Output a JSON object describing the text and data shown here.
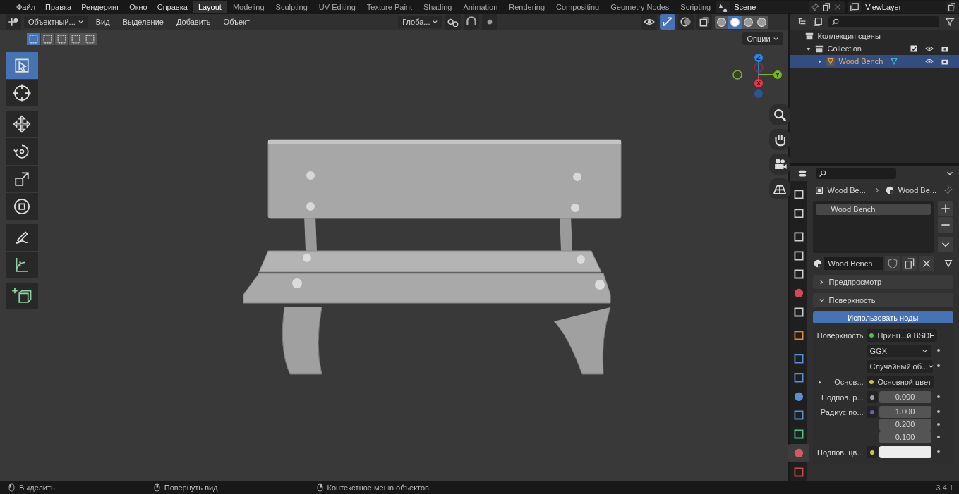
{
  "menu_bar": {
    "items": [
      "Файл",
      "Правка",
      "Рендеринг",
      "Окно",
      "Справка"
    ]
  },
  "workspace_tabs": [
    {
      "label": "Layout",
      "selected": true
    },
    {
      "label": "Modeling",
      "selected": false
    },
    {
      "label": "Sculpting",
      "selected": false
    },
    {
      "label": "UV Editing",
      "selected": false
    },
    {
      "label": "Texture Paint",
      "selected": false
    },
    {
      "label": "Shading",
      "selected": false
    },
    {
      "label": "Animation",
      "selected": false
    },
    {
      "label": "Rendering",
      "selected": false
    },
    {
      "label": "Compositing",
      "selected": false
    },
    {
      "label": "Geometry Nodes",
      "selected": false
    },
    {
      "label": "Scripting",
      "selected": false
    }
  ],
  "scene": {
    "name": "Scene"
  },
  "view_layer": {
    "name": "ViewLayer"
  },
  "viewport_header": {
    "mode": "Объектный...",
    "menus": [
      "Вид",
      "Выделение",
      "Добавить",
      "Объект"
    ],
    "orientation": "Глоба...",
    "options": "Опции",
    "shading_modes": [
      {
        "selected": false
      },
      {
        "selected": true
      },
      {
        "selected": false
      },
      {
        "selected": false
      }
    ],
    "select_modes": [
      {
        "selected": true
      },
      {
        "selected": false
      },
      {
        "selected": false
      },
      {
        "selected": false
      },
      {
        "selected": false
      }
    ]
  },
  "tools": [
    {
      "kind": "select",
      "selected": true
    },
    {
      "kind": "cursor",
      "selected": false
    },
    {
      "kind": "move",
      "selected": false
    },
    {
      "kind": "rotate",
      "selected": false
    },
    {
      "kind": "scale",
      "selected": false
    },
    {
      "kind": "transform",
      "selected": false
    },
    {
      "kind": "annotate",
      "selected": false
    },
    {
      "kind": "measure",
      "selected": false
    },
    {
      "kind": "add",
      "selected": false
    }
  ],
  "gizmo": [
    {
      "label": "Z",
      "color": "#2f83e3"
    },
    {
      "label": "Y",
      "color": "#7ab61f"
    },
    {
      "label": "X",
      "color": "#e8364f"
    }
  ],
  "outliner": {
    "root": "Коллекция сцены",
    "children": [
      {
        "name": "Collection",
        "expanded": true,
        "children": [
          {
            "name": "Wood Bench",
            "selected": true,
            "expanded": false
          }
        ]
      }
    ]
  },
  "properties": {
    "tabs": [
      {
        "kind": "tool",
        "selected": false
      },
      {
        "kind": "render",
        "selected": false
      },
      {
        "kind": "output",
        "selected": false
      },
      {
        "kind": "view-layer",
        "selected": false
      },
      {
        "kind": "scene",
        "selected": false
      },
      {
        "kind": "world",
        "selected": false
      },
      {
        "kind": "collection",
        "selected": false
      },
      {
        "kind": "object",
        "selected": false
      },
      {
        "kind": "modifier",
        "selected": false
      },
      {
        "kind": "particles",
        "selected": false
      },
      {
        "kind": "physics",
        "selected": false
      },
      {
        "kind": "constraint",
        "selected": false
      },
      {
        "kind": "data",
        "selected": false
      },
      {
        "kind": "material",
        "selected": true
      },
      {
        "kind": "texture",
        "selected": false
      }
    ],
    "breadcrumb": [
      "Wood Be...",
      "Wood Be..."
    ],
    "material_slots": [
      {
        "name": "Wood Bench",
        "selected": true
      }
    ],
    "material_name": "Wood Bench",
    "panels": [
      {
        "label": "Предпросмотр",
        "expanded": false
      },
      {
        "label": "Поверхность",
        "expanded": true
      }
    ],
    "use_nodes_button": "Использовать ноды",
    "rows": [
      {
        "kind": "link",
        "label": "Поверхность",
        "value": "Принц...й BSDF",
        "color": "#4fc04f"
      },
      {
        "kind": "dropdown",
        "value": "GGX"
      },
      {
        "kind": "dropdown",
        "value": "Случайный об..."
      },
      {
        "kind": "sublink",
        "label": "Основ...",
        "value": "Основной цвет",
        "color": "#c7c74a"
      },
      {
        "kind": "number",
        "label": "Подпов. р...",
        "color": "#a1a1a1",
        "values": [
          "0.000"
        ]
      },
      {
        "kind": "number",
        "label": "Радиус по...",
        "color": "#6363c7",
        "values": [
          "1.000",
          "0.200",
          "0.100"
        ]
      },
      {
        "kind": "swatch",
        "label": "Подпов. цв...",
        "color": "#c7c74a"
      }
    ]
  },
  "status_bar": {
    "hints": [
      "Выделить",
      "Повернуть вид",
      "Контекстное меню объектов"
    ],
    "version": "3.4.1"
  }
}
